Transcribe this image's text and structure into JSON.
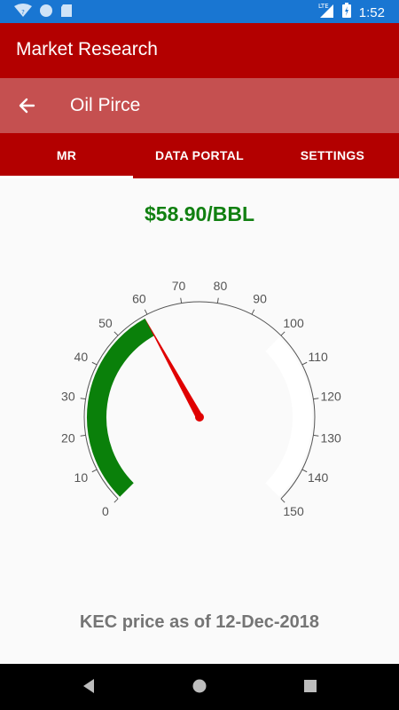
{
  "status_bar": {
    "network": "LTE",
    "time": "1:52"
  },
  "app_bar": {
    "title": "Market Research"
  },
  "sub_bar": {
    "title": "Oil Pirce"
  },
  "tabs": [
    {
      "label": "MR",
      "active": true
    },
    {
      "label": "DATA PORTAL",
      "active": false
    },
    {
      "label": "SETTINGS",
      "active": false
    }
  ],
  "price": {
    "text": "$58.90/BBL"
  },
  "gauge": {
    "value": 58.9,
    "min": 0,
    "max": 150,
    "tick_labels": [
      "0",
      "10",
      "20",
      "30",
      "40",
      "50",
      "60",
      "70",
      "80",
      "90",
      "100",
      "110",
      "120",
      "130",
      "140",
      "150"
    ],
    "range_colors": {
      "low": "#0a800a",
      "high": "#ffffff",
      "needle": "#e00000"
    },
    "low_range": [
      0,
      58.9
    ],
    "high_range": [
      100,
      150
    ]
  },
  "caption": {
    "text": "KEC price as of 12-Dec-2018"
  },
  "colors": {
    "app_bar": "#b30000",
    "sub_bar": "#c55050",
    "status_bar": "#1976d2",
    "price_text": "#118011"
  }
}
